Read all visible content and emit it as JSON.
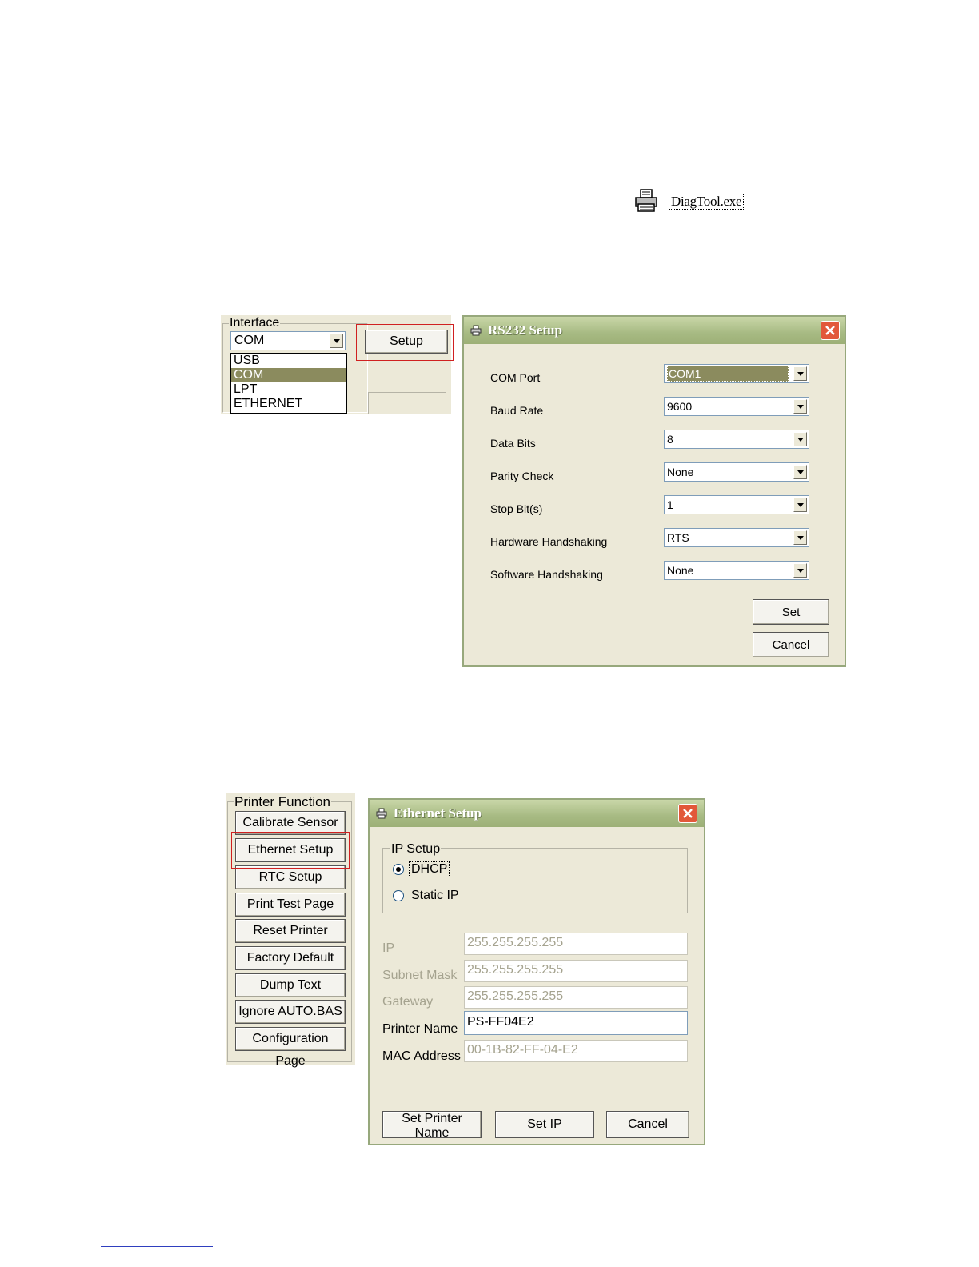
{
  "desktop_icon": {
    "label": "DiagTool.exe",
    "icon": "printer-icon"
  },
  "interface_panel": {
    "group_label": "Interface",
    "selected": "COM",
    "options": [
      "USB",
      "COM",
      "LPT",
      "ETHERNET"
    ],
    "setup_label": "Setup"
  },
  "rs232": {
    "title": "RS232 Setup",
    "fields": [
      {
        "label": "COM Port",
        "value": "COM1"
      },
      {
        "label": "Baud Rate",
        "value": "9600"
      },
      {
        "label": "Data Bits",
        "value": "8"
      },
      {
        "label": "Parity Check",
        "value": "None"
      },
      {
        "label": "Stop Bit(s)",
        "value": "1"
      },
      {
        "label": "Hardware Handshaking",
        "value": "RTS"
      },
      {
        "label": "Software Handshaking",
        "value": "None"
      }
    ],
    "set_label": "Set",
    "cancel_label": "Cancel"
  },
  "printer_function": {
    "group_label": "Printer Function",
    "buttons": [
      "Calibrate Sensor",
      "Ethernet Setup",
      "RTC Setup",
      "Print Test Page",
      "Reset Printer",
      "Factory Default",
      "Dump Text",
      "Ignore AUTO.BAS",
      "Configuration Page"
    ]
  },
  "ethernet": {
    "title": "Ethernet Setup",
    "ip_group_label": "IP Setup",
    "dhcp_label": "DHCP",
    "static_label": "Static IP",
    "fields": [
      {
        "label": "IP",
        "value": "255.255.255.255"
      },
      {
        "label": "Subnet Mask",
        "value": "255.255.255.255"
      },
      {
        "label": "Gateway",
        "value": "255.255.255.255"
      },
      {
        "label": "Printer Name",
        "value": "PS-FF04E2"
      },
      {
        "label": "MAC Address",
        "value": "00-1B-82-FF-04-E2"
      }
    ],
    "set_printer_name_label": "Set Printer Name",
    "set_ip_label": "Set IP",
    "cancel_label": "Cancel"
  },
  "colors": {
    "accent_red": "#d02020",
    "titlebar": "#a7ba83",
    "selection": "#8b8b5e",
    "close": "#e2583a"
  }
}
